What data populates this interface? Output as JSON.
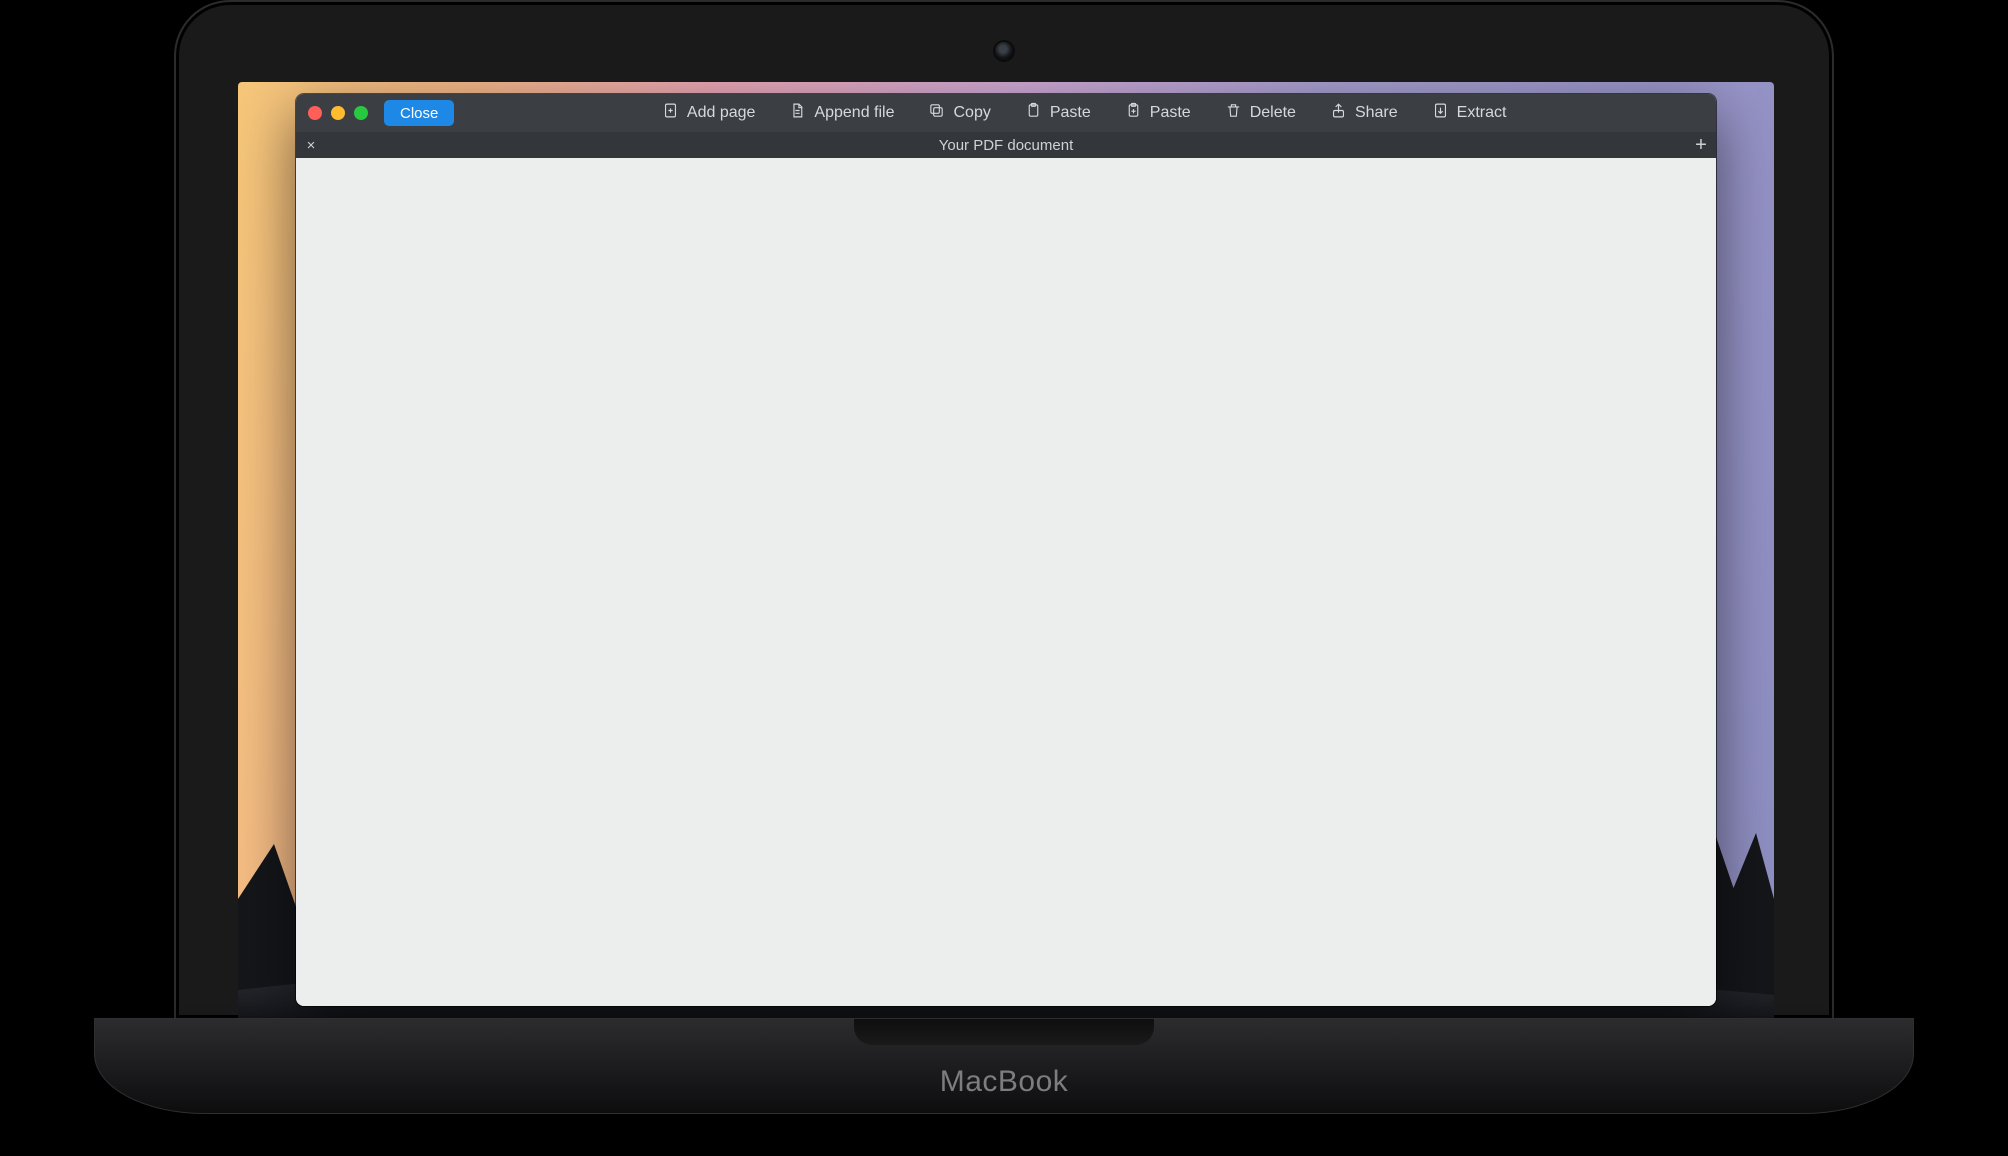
{
  "device": {
    "brand": "MacBook"
  },
  "window": {
    "traffic": {
      "close": "close",
      "min": "minimize",
      "max": "maximize"
    },
    "close_button": "Close",
    "toolbar": [
      {
        "id": "add-page",
        "label": "Add page",
        "icon": "page-plus-icon"
      },
      {
        "id": "append-file",
        "label": "Append file",
        "icon": "file-icon"
      },
      {
        "id": "copy",
        "label": "Copy",
        "icon": "copy-icon"
      },
      {
        "id": "paste",
        "label": "Paste",
        "icon": "paste-icon"
      },
      {
        "id": "paste2",
        "label": "Paste",
        "icon": "paste-icon"
      },
      {
        "id": "delete",
        "label": "Delete",
        "icon": "trash-icon"
      },
      {
        "id": "share",
        "label": "Share",
        "icon": "share-icon"
      },
      {
        "id": "extract",
        "label": "Extract",
        "icon": "extract-icon"
      }
    ],
    "tab": {
      "title": "Your PDF document"
    }
  }
}
